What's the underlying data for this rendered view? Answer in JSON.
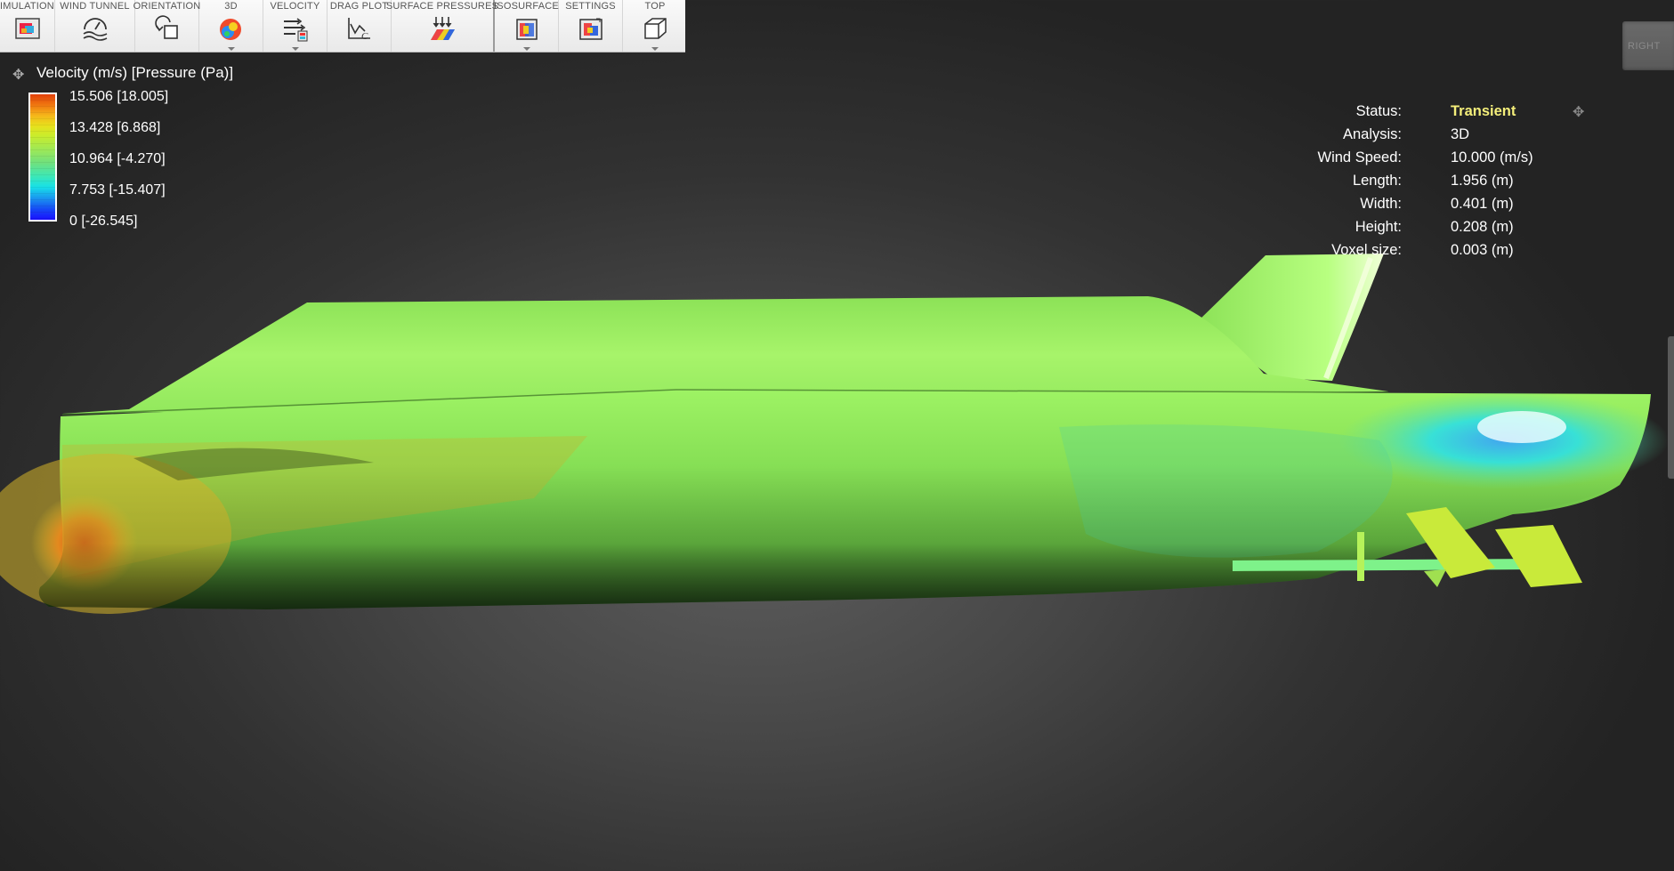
{
  "toolbar": {
    "groups": [
      {
        "buttons": [
          {
            "label": "IMULATION",
            "icon": "simulation-icon"
          },
          {
            "label": "WIND TUNNEL",
            "icon": "wind-tunnel-icon"
          },
          {
            "label": "ORIENTATION",
            "icon": "orientation-icon"
          },
          {
            "label": "3D",
            "icon": "3d-flow-icon"
          },
          {
            "label": "VELOCITY",
            "icon": "velocity-icon"
          },
          {
            "label": "DRAG PLOT",
            "icon": "drag-plot-icon"
          },
          {
            "label": "SURFACE PRESSURES",
            "icon": "surface-pressures-icon"
          }
        ]
      },
      {
        "buttons": [
          {
            "label": "ISOSURFACE",
            "icon": "isosurface-icon"
          },
          {
            "label": "SETTINGS",
            "icon": "settings-icon"
          },
          {
            "label": "TOP",
            "icon": "top-view-cube-icon"
          }
        ]
      }
    ]
  },
  "legend": {
    "title": "Velocity (m/s) [Pressure (Pa)]",
    "ticks": [
      "15.506 [18.005]",
      "13.428 [6.868]",
      "10.964 [-4.270]",
      "7.753 [-15.407]",
      "0 [-26.545]"
    ],
    "colors": [
      "#e2400a",
      "#f5b71a",
      "#e8e01c",
      "#9ae85a",
      "#3ee8b4",
      "#17e0e8",
      "#1646f5",
      "#1a10ff"
    ]
  },
  "status": {
    "rows": [
      {
        "label": "Status:",
        "value": "Transient"
      },
      {
        "label": "Analysis:",
        "value": "3D"
      },
      {
        "label": "Wind Speed:",
        "value": "10.000 (m/s)"
      },
      {
        "label": "Length:",
        "value": "1.956 (m)"
      },
      {
        "label": "Width:",
        "value": "0.401 (m)"
      },
      {
        "label": "Height:",
        "value": "0.208 (m)"
      },
      {
        "label": "Voxel size:",
        "value": "0.003 (m)"
      }
    ],
    "highlight_color": "#f4ee7a"
  },
  "viewcube": {
    "face_label": "RIGHT"
  },
  "model": {
    "base_color": "#8fea5a",
    "high_color": "#e0641a",
    "low_color": "#2dd6e8"
  }
}
